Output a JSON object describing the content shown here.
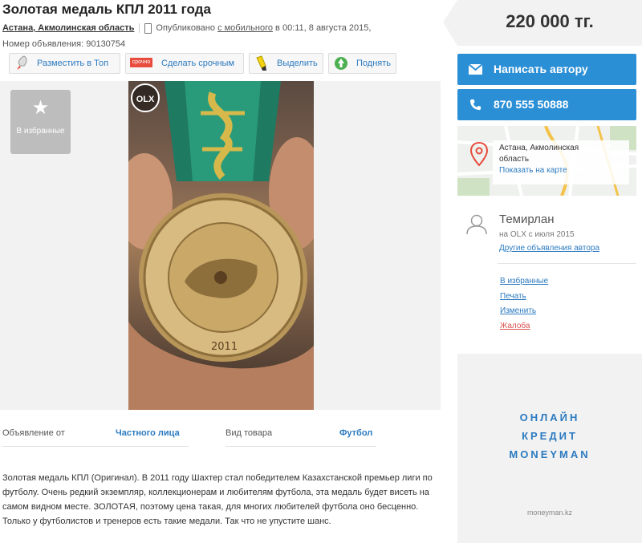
{
  "listing": {
    "title": "Золотая медаль КПЛ 2011 года",
    "location": "Астана, Акмолинская область",
    "published_prefix": "Опубликовано",
    "published_link": "с мобильного",
    "published_suffix": "в 00:11, 8 августа 2015,",
    "ad_number": "Номер объявления: 90130754"
  },
  "toolbar": {
    "top_label": "Разместить в Топ",
    "urgent_label": "Сделать срочным",
    "urgent_badge": "срочно",
    "highlight_label": "Выделить",
    "raise_label": "Поднять"
  },
  "gallery": {
    "favorite_label": "В избранные",
    "watermark": "OLX",
    "medal_text_year": "2011"
  },
  "params": {
    "from_label": "Объявление от",
    "from_value": "Частного лица",
    "type_label": "Вид товара",
    "type_value": "Футбол"
  },
  "description": "Золотая медаль КПЛ (Оригинал). В 2011 году Шахтер стал победителем Казахстанской премьер лиги по футболу. Очень редкий экземпляр, коллекционерам и любителям футбола, эта медаль будет висеть на самом видном месте. ЗОЛОТАЯ, поэтому цена такая, для многих любителей футбола оно бесценно. Только у футболистов и тренеров есть такие медали. Так что не упустите шанс.",
  "sidebar": {
    "price": "220 000 тг.",
    "write_author": "Написать автору",
    "phone": "870 555 50888",
    "map_city": "Астана, Акмолинская",
    "map_region": "область",
    "map_link": "Показать на карте",
    "user_name": "Темирлан",
    "user_since": "на OLX с июля 2015",
    "user_other": "Другие объявления автора",
    "links": {
      "favorites": "В избранные",
      "print": "Печать",
      "edit": "Изменить",
      "complaint": "Жалоба"
    }
  },
  "ad": {
    "line1": "ОНЛАЙН",
    "line2": "КРЕДИТ",
    "line3": "MONEYMAN",
    "site": "moneyman.kz"
  },
  "colors": {
    "accent": "#2b8fd6",
    "link": "#2b7ac0",
    "complaint": "#d9534f"
  }
}
